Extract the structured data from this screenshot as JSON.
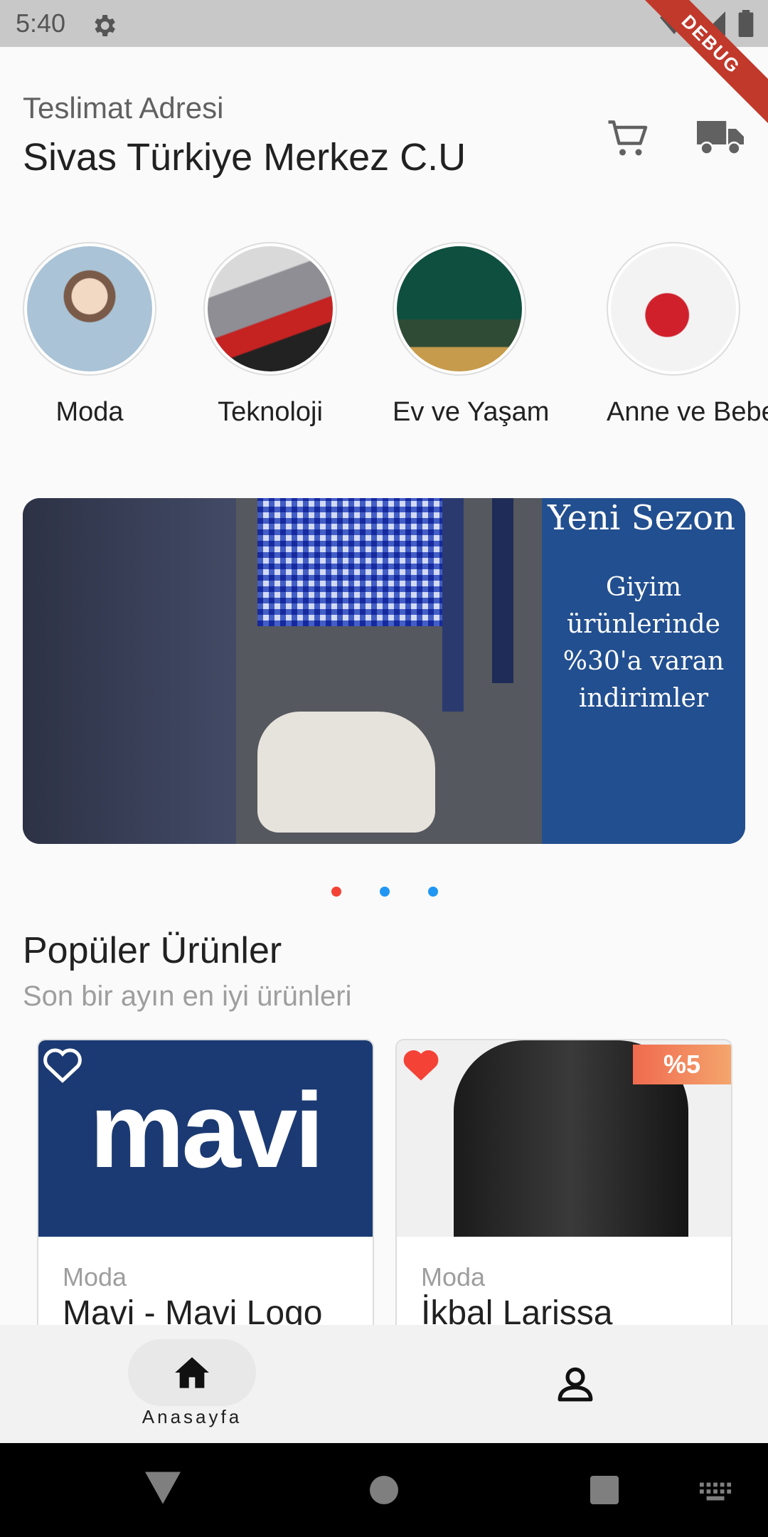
{
  "status_bar": {
    "time": "5:40",
    "debug_label": "DEBUG"
  },
  "header": {
    "address_label": "Teslimat Adresi",
    "address_value": "Sivas Türkiye Merkez C.U",
    "cart_icon": "cart-icon",
    "truck_icon": "truck-icon"
  },
  "categories": [
    {
      "label": "Moda",
      "icon": "fashion-image"
    },
    {
      "label": "Teknoloji",
      "icon": "laptop-image"
    },
    {
      "label": "Ev ve Yaşam",
      "icon": "living-room-image"
    },
    {
      "label": "Anne ve Bebek",
      "icon": "baby-products-image"
    }
  ],
  "banner": {
    "title": "Yeni Sezon",
    "subtitle": "Giyim ürünlerinde %30'a varan indirimler",
    "active_index": 0,
    "dot_count": 3
  },
  "popular": {
    "title": "Popüler Ürünler",
    "subtitle": "Son bir ayın en iyi ürünleri",
    "products": [
      {
        "category": "Moda",
        "name": "Mavi - Mavi Logo",
        "brand_text": "mavi",
        "favorite": false,
        "discount": ""
      },
      {
        "category": "Moda",
        "name": "İkbal Larissa",
        "favorite": true,
        "discount": "%5"
      }
    ]
  },
  "bottom_nav": {
    "home_label": "Anasayfa",
    "home_icon": "home-icon",
    "profile_icon": "profile-icon"
  },
  "colors": {
    "accent_red": "#f44336",
    "dot_blue": "#2196f3",
    "banner_blue": "#224f8f",
    "mavi_blue": "#1b3a73"
  }
}
